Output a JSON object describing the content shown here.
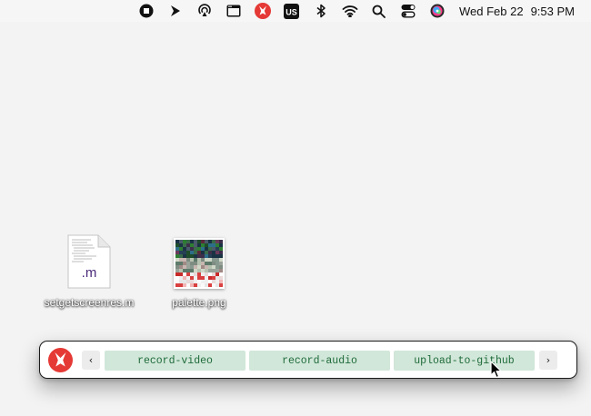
{
  "menubar": {
    "status_icons": [
      "stop-record-icon",
      "play-arrow-icon",
      "airplay-audio-icon",
      "window-icon",
      "launcher-app-icon",
      "input-source-icon",
      "bluetooth-icon",
      "wifi-icon",
      "spotlight-search-icon",
      "control-center-icon",
      "siri-icon"
    ],
    "input_source": "US",
    "date": "Wed Feb 22",
    "time": "9:53 PM"
  },
  "desktop": {
    "files": [
      {
        "name": "setgetscreenres.m",
        "icon": "objc-document-icon",
        "ext": ".m"
      },
      {
        "name": "palette.png",
        "icon": "png-image-thumbnail"
      }
    ]
  },
  "launcher": {
    "prev_label": "‹",
    "next_label": "›",
    "commands": [
      "record-video",
      "record-audio",
      "upload-to-github"
    ],
    "accent": "#e53935",
    "button_bg": "#d1e7d9",
    "button_text": "#1f6b3a"
  }
}
